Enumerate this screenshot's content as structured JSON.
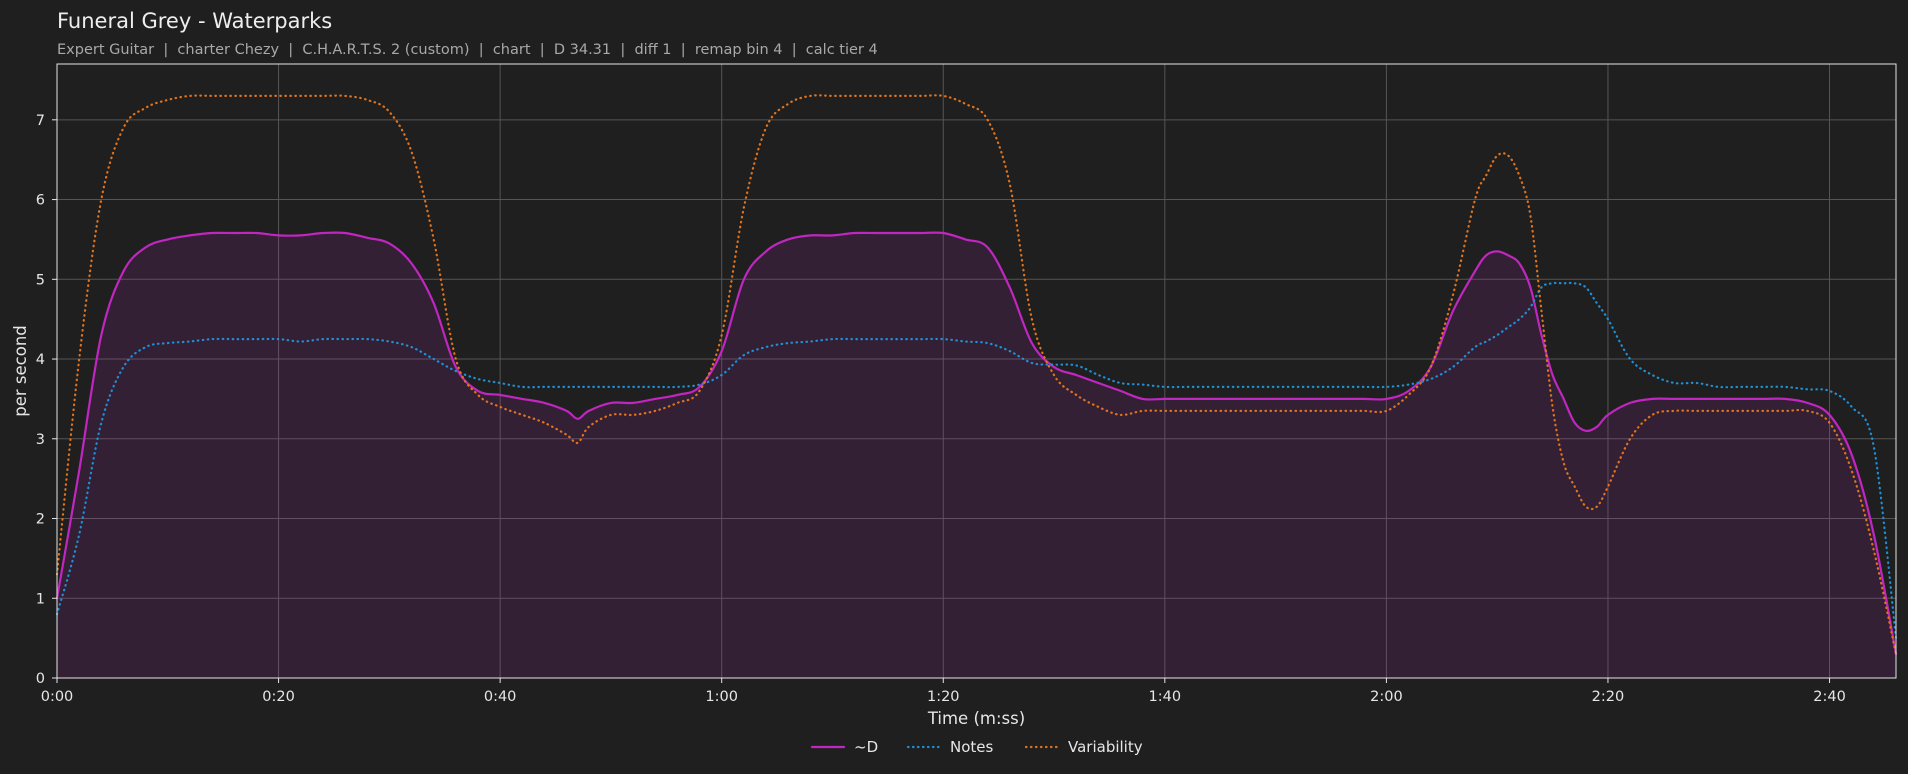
{
  "chart_data": {
    "type": "line",
    "title": "Funeral Grey - Waterparks",
    "subtitle": "Expert Guitar  |  charter Chezy  |  C.H.A.R.T.S. 2 (custom)  |  chart  |  D 34.31  |  diff 1  |  remap bin 4  |  calc tier 4",
    "xlabel": "Time (m:ss)",
    "ylabel": "per second",
    "xlim": [
      0,
      166
    ],
    "ylim": [
      0,
      7.7
    ],
    "grid": true,
    "legend_position": "bottom-center",
    "xticks": [
      {
        "value": 0,
        "label": "0:00"
      },
      {
        "value": 20,
        "label": "0:20"
      },
      {
        "value": 40,
        "label": "0:40"
      },
      {
        "value": 60,
        "label": "1:00"
      },
      {
        "value": 80,
        "label": "1:20"
      },
      {
        "value": 100,
        "label": "1:40"
      },
      {
        "value": 120,
        "label": "2:00"
      },
      {
        "value": 140,
        "label": "2:20"
      },
      {
        "value": 160,
        "label": "2:40"
      }
    ],
    "yticks": [
      {
        "value": 0,
        "label": "0"
      },
      {
        "value": 1,
        "label": "1"
      },
      {
        "value": 2,
        "label": "2"
      },
      {
        "value": 3,
        "label": "3"
      },
      {
        "value": 4,
        "label": "4"
      },
      {
        "value": 5,
        "label": "5"
      },
      {
        "value": 6,
        "label": "6"
      },
      {
        "value": 7,
        "label": "7"
      }
    ],
    "x": [
      0,
      2,
      4,
      6,
      8,
      10,
      12,
      14,
      16,
      18,
      20,
      22,
      24,
      26,
      28,
      30,
      32,
      34,
      36,
      38,
      40,
      42,
      44,
      46,
      47,
      48,
      50,
      52,
      54,
      56,
      58,
      60,
      62,
      64,
      66,
      68,
      70,
      72,
      74,
      76,
      78,
      80,
      82,
      84,
      86,
      88,
      90,
      92,
      94,
      96,
      98,
      100,
      102,
      104,
      106,
      108,
      110,
      112,
      114,
      116,
      118,
      120,
      122,
      124,
      126,
      128,
      129,
      130,
      131,
      132,
      133,
      134,
      135,
      136,
      137,
      138,
      139,
      140,
      142,
      144,
      146,
      148,
      150,
      152,
      154,
      156,
      158,
      160,
      162,
      164,
      166
    ],
    "series": [
      {
        "name": "~D",
        "style": "solid",
        "fill": true,
        "color": "#c026c0",
        "values": [
          1.0,
          2.6,
          4.3,
          5.1,
          5.4,
          5.5,
          5.55,
          5.58,
          5.58,
          5.58,
          5.55,
          5.55,
          5.58,
          5.58,
          5.52,
          5.45,
          5.2,
          4.7,
          3.9,
          3.6,
          3.55,
          3.5,
          3.45,
          3.35,
          3.25,
          3.35,
          3.45,
          3.45,
          3.5,
          3.55,
          3.65,
          4.1,
          5.0,
          5.35,
          5.5,
          5.55,
          5.55,
          5.58,
          5.58,
          5.58,
          5.58,
          5.58,
          5.5,
          5.4,
          4.9,
          4.2,
          3.9,
          3.8,
          3.7,
          3.6,
          3.5,
          3.5,
          3.5,
          3.5,
          3.5,
          3.5,
          3.5,
          3.5,
          3.5,
          3.5,
          3.5,
          3.5,
          3.6,
          3.9,
          4.6,
          5.1,
          5.3,
          5.35,
          5.3,
          5.2,
          4.9,
          4.3,
          3.8,
          3.5,
          3.2,
          3.1,
          3.15,
          3.3,
          3.45,
          3.5,
          3.5,
          3.5,
          3.5,
          3.5,
          3.5,
          3.5,
          3.45,
          3.3,
          2.8,
          1.8,
          0.3
        ]
      },
      {
        "name": "Notes",
        "style": "dotted",
        "fill": false,
        "color": "#1f8fd6",
        "values": [
          0.8,
          1.8,
          3.2,
          3.9,
          4.15,
          4.2,
          4.22,
          4.25,
          4.25,
          4.25,
          4.25,
          4.22,
          4.25,
          4.25,
          4.25,
          4.22,
          4.15,
          4.0,
          3.85,
          3.75,
          3.7,
          3.65,
          3.65,
          3.65,
          3.65,
          3.65,
          3.65,
          3.65,
          3.65,
          3.65,
          3.68,
          3.8,
          4.05,
          4.15,
          4.2,
          4.22,
          4.25,
          4.25,
          4.25,
          4.25,
          4.25,
          4.25,
          4.22,
          4.2,
          4.1,
          3.95,
          3.93,
          3.92,
          3.8,
          3.7,
          3.68,
          3.65,
          3.65,
          3.65,
          3.65,
          3.65,
          3.65,
          3.65,
          3.65,
          3.65,
          3.65,
          3.65,
          3.68,
          3.75,
          3.9,
          4.15,
          4.22,
          4.3,
          4.4,
          4.5,
          4.65,
          4.9,
          4.95,
          4.95,
          4.95,
          4.9,
          4.7,
          4.5,
          4.0,
          3.8,
          3.7,
          3.7,
          3.65,
          3.65,
          3.65,
          3.65,
          3.62,
          3.6,
          3.4,
          2.9,
          0.5
        ]
      },
      {
        "name": "Variability",
        "style": "dotted",
        "fill": false,
        "color": "#e0731e",
        "values": [
          1.3,
          4.0,
          6.0,
          6.9,
          7.15,
          7.25,
          7.3,
          7.3,
          7.3,
          7.3,
          7.3,
          7.3,
          7.3,
          7.3,
          7.25,
          7.1,
          6.6,
          5.5,
          4.0,
          3.55,
          3.4,
          3.3,
          3.2,
          3.05,
          2.95,
          3.15,
          3.3,
          3.3,
          3.35,
          3.45,
          3.6,
          4.3,
          5.9,
          6.9,
          7.2,
          7.3,
          7.3,
          7.3,
          7.3,
          7.3,
          7.3,
          7.3,
          7.2,
          7.0,
          6.2,
          4.5,
          3.8,
          3.55,
          3.4,
          3.3,
          3.35,
          3.35,
          3.35,
          3.35,
          3.35,
          3.35,
          3.35,
          3.35,
          3.35,
          3.35,
          3.35,
          3.35,
          3.55,
          3.9,
          4.8,
          6.0,
          6.3,
          6.55,
          6.55,
          6.3,
          5.8,
          4.6,
          3.4,
          2.7,
          2.4,
          2.15,
          2.15,
          2.4,
          3.0,
          3.3,
          3.35,
          3.35,
          3.35,
          3.35,
          3.35,
          3.35,
          3.35,
          3.2,
          2.6,
          1.6,
          0.3
        ]
      }
    ]
  }
}
